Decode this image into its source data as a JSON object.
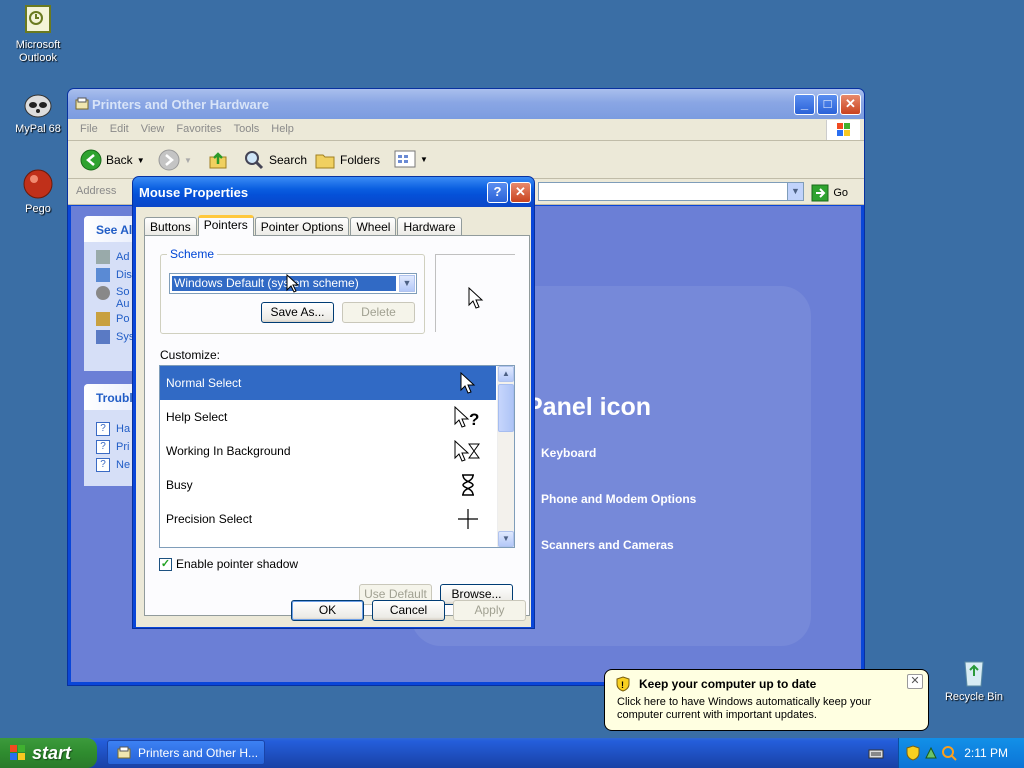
{
  "desktop": {
    "icons": [
      {
        "label": "Microsoft Outlook"
      },
      {
        "label": "MyPal 68"
      },
      {
        "label": "Pego"
      },
      {
        "label": "Recycle Bin"
      }
    ]
  },
  "explorer": {
    "title": "Printers and Other Hardware",
    "menu": [
      "File",
      "Edit",
      "View",
      "Favorites",
      "Tools",
      "Help"
    ],
    "toolbar": {
      "back": "Back",
      "search": "Search",
      "folders": "Folders"
    },
    "address_label": "Address",
    "go_label": "Go",
    "see_also_header": "See Al",
    "see_also_items": [
      "Ad",
      "Dis",
      "So",
      "Po",
      "Sys"
    ],
    "see_also_item_extra": "Au",
    "troubleshoot_header": "Troubl",
    "troubleshoot_items": [
      "Ha",
      "Pri",
      "Ne"
    ],
    "panel_title": "Panel icon",
    "panel_links": [
      "Keyboard",
      "Phone and Modem Options",
      "Scanners and Cameras"
    ]
  },
  "dialog": {
    "title": "Mouse Properties",
    "tabs": [
      "Buttons",
      "Pointers",
      "Pointer Options",
      "Wheel",
      "Hardware"
    ],
    "active_tab": "Pointers",
    "scheme_legend": "Scheme",
    "scheme_value": "Windows Default (system scheme)",
    "save_as": "Save As...",
    "delete": "Delete",
    "customize_label": "Customize:",
    "pointers": [
      {
        "name": "Normal Select",
        "icon": "arrow-cursor-icon"
      },
      {
        "name": "Help Select",
        "icon": "help-cursor-icon"
      },
      {
        "name": "Working In Background",
        "icon": "working-cursor-icon"
      },
      {
        "name": "Busy",
        "icon": "hourglass-cursor-icon"
      },
      {
        "name": "Precision Select",
        "icon": "crosshair-cursor-icon"
      }
    ],
    "enable_shadow": "Enable pointer shadow",
    "use_default": "Use Default",
    "browse": "Browse...",
    "ok": "OK",
    "cancel": "Cancel",
    "apply": "Apply"
  },
  "taskbar": {
    "start": "start",
    "task_button": "Printers and Other H...",
    "clock": "2:11 PM"
  },
  "balloon": {
    "title": "Keep your computer up to date",
    "text": "Click here to have Windows automatically keep your computer current with important updates."
  }
}
